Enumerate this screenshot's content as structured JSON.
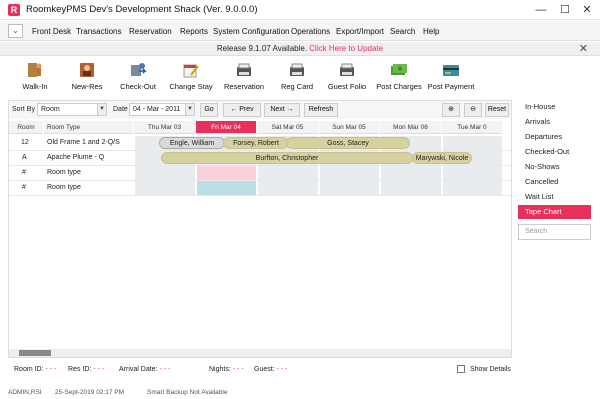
{
  "window": {
    "logo": "R",
    "title": "RoomkeyPMS  Dev's Development Shack (Ver. 9.0.0.0)",
    "minimize": "—",
    "maximize": "☐",
    "close": "✕"
  },
  "menu": {
    "dropdown": "⌄",
    "items": [
      "Front Desk",
      "Transactions",
      "Reservation",
      "Reports",
      "System Configuration",
      "Operations",
      "Export/Import",
      "Search",
      "Help"
    ]
  },
  "update": {
    "text": "Release 9.1.07 Available. ",
    "link": "Click Here to Update",
    "close": "✕"
  },
  "toolbar": {
    "items": [
      {
        "label": "Walk-In",
        "icon": "walk-in-icon"
      },
      {
        "label": "New-Res",
        "icon": "new-reservation-icon"
      },
      {
        "label": "Check-Out",
        "icon": "check-out-icon"
      },
      {
        "label": "Change Stay",
        "icon": "change-stay-icon"
      },
      {
        "label": "Reservation",
        "icon": "reservation-icon"
      },
      {
        "label": "Reg Card",
        "icon": "printer-icon"
      },
      {
        "label": "Guest Folio",
        "icon": "printer-icon"
      },
      {
        "label": "Post Charges",
        "icon": "money-icon"
      },
      {
        "label": "Post Payment",
        "icon": "payment-icon"
      }
    ]
  },
  "controls": {
    "sort_by_label": "Sort By",
    "sort_by_value": "Room",
    "date_label": "Date",
    "date_value": "04 - Mar - 2011",
    "go": "Go",
    "prev": "← Prev",
    "next": "Next →",
    "refresh": "Refresh",
    "zoom_in": "⊕",
    "zoom_out": "⊖",
    "reset": "Reset"
  },
  "grid": {
    "col_room": "Room",
    "col_type": "Room Type",
    "dates": [
      "Thu  Mar  03",
      "Fri  Mar  04",
      "Sat  Mar  05",
      "Sun  Mar  05",
      "Mon  Mar  06",
      "Tue  Mar  0"
    ],
    "selected_date_index": 1,
    "rows": [
      {
        "room": "12",
        "type": "Old Frame 1 and 2-Q/S"
      },
      {
        "room": "A",
        "type": "Apache Plume - Q"
      },
      {
        "room": "#",
        "type": "Room type"
      },
      {
        "room": "#",
        "type": "Room type"
      }
    ],
    "bookings": [
      {
        "name": "Engle, William",
        "color": "#dadada",
        "border": "#aaaaaa"
      },
      {
        "name": "Forsey, Robert",
        "color": "#d6d2a0",
        "border": "#b8b080"
      },
      {
        "name": "Goss, Stacey",
        "color": "#d6d2a0",
        "border": "#b8b080"
      },
      {
        "name": "Burfton, Christopher",
        "color": "#d6d2a0",
        "border": "#b8b080"
      },
      {
        "name": "Marywski, Nicole",
        "color": "#d6d2a0",
        "border": "#b8b080"
      }
    ]
  },
  "details": {
    "room_id_label": "Room ID:",
    "room_id": "- - -",
    "res_id_label": "Res ID:",
    "res_id": "- - -",
    "arrival_label": "Arrival Date:",
    "arrival": "- - -",
    "nights_label": "Nights:",
    "nights": "- - -",
    "guest_label": "Guest:",
    "guest": "- - -",
    "show_details": "Show Details"
  },
  "footer": {
    "user": "ADMIN,RSI",
    "datetime": "25-Sept-2019 02:17 PM",
    "backup": "Smart Backup Not Available"
  },
  "rightpanel": {
    "items": [
      "In-House",
      "Arrivals",
      "Departures",
      "Checked-Out",
      "No-Shows",
      "Cancelled",
      "Wait List",
      "Tape Chart"
    ],
    "active_index": 7,
    "search_placeholder": "Search"
  },
  "colors": {
    "accent": "#e8305a",
    "booking": "#d6d2a0",
    "cell": "#e8ecef",
    "pink_cell": "#f9cfd9",
    "blue_cell": "#bcdde4"
  }
}
